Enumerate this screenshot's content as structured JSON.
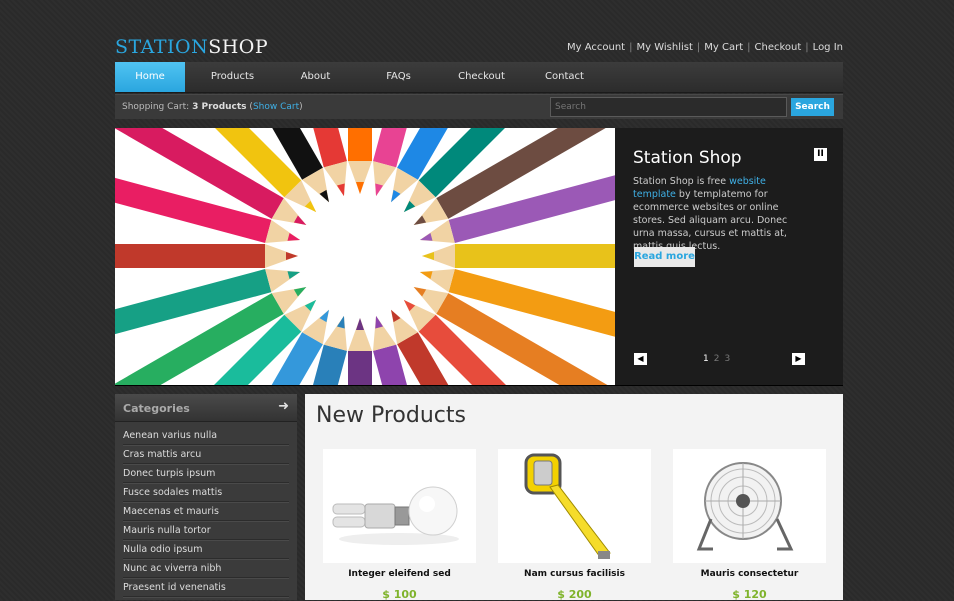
{
  "logo": {
    "part1": "STATION",
    "part2": "SHOP"
  },
  "top_links": [
    "My Account",
    "My Wishlist",
    "My Cart",
    "Checkout",
    "Log In"
  ],
  "menu": [
    {
      "label": "Home",
      "active": true
    },
    {
      "label": "Products",
      "active": false
    },
    {
      "label": "About",
      "active": false
    },
    {
      "label": "FAQs",
      "active": false
    },
    {
      "label": "Checkout",
      "active": false
    },
    {
      "label": "Contact",
      "active": false
    }
  ],
  "cart": {
    "prefix": "Shopping Cart:",
    "count": "3 Products",
    "open_paren": "(",
    "link": "Show Cart",
    "close_paren": ")"
  },
  "search": {
    "placeholder": "Search",
    "button": "Search"
  },
  "slider": {
    "title": "Station Shop",
    "text_before": "Station Shop is free ",
    "text_link": "website template",
    "text_after": " by templatemo for ecommerce websites or online stores. Sed aliquam arcu. Donec urna massa, cursus et mattis at, mattis quis lectus.",
    "read_more": "Read more",
    "pages": [
      "1",
      "2",
      "3"
    ],
    "current_page": "1",
    "pause_icon": "II",
    "prev_icon": "◀",
    "next_icon": "▶"
  },
  "sidebar": {
    "title": "Categories",
    "arrow": "➜",
    "items": [
      "Aenean varius nulla",
      "Cras mattis arcu",
      "Donec turpis ipsum",
      "Fusce sodales mattis",
      "Maecenas et mauris",
      "Mauris nulla tortor",
      "Nulla odio ipsum",
      "Nunc ac viverra nibh",
      "Praesent id venenatis"
    ]
  },
  "main": {
    "title": "New Products",
    "products": [
      {
        "name": "Integer eleifend sed",
        "price": "$ 100"
      },
      {
        "name": "Nam cursus facilisis",
        "price": "$ 200"
      },
      {
        "name": "Mauris consectetur",
        "price": "$ 120"
      }
    ]
  }
}
